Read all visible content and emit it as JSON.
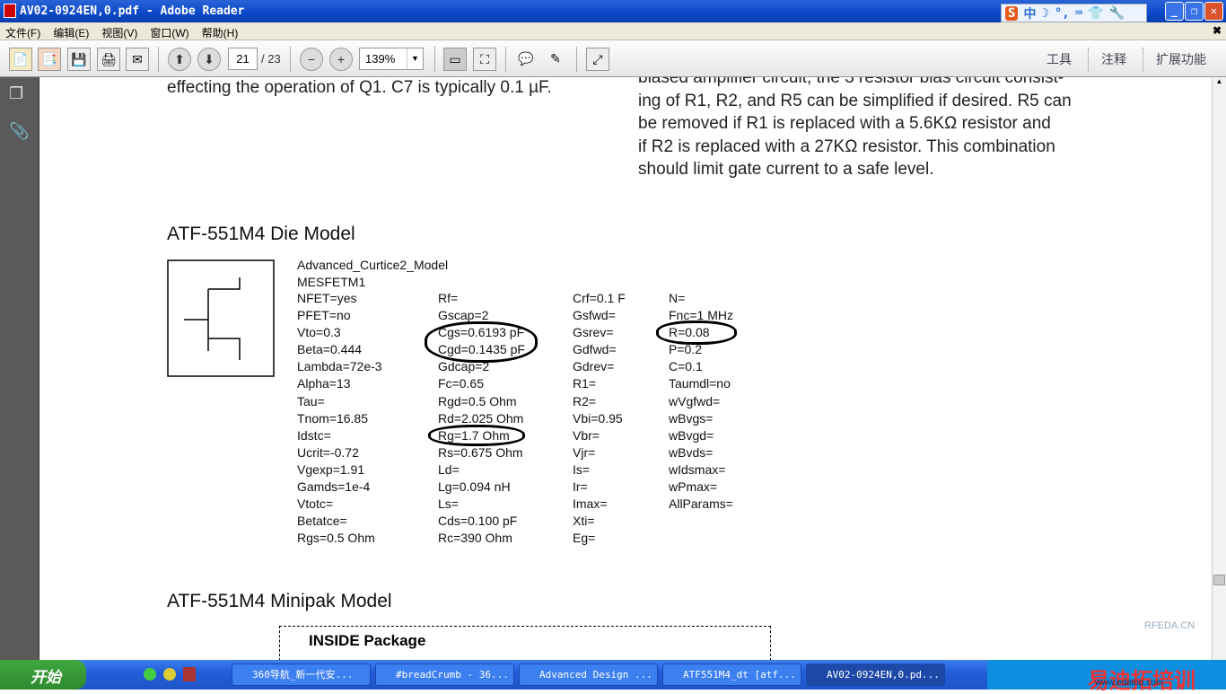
{
  "window": {
    "title": "AV02-0924EN,0.pdf - Adobe Reader",
    "ime": [
      "中",
      "☽",
      "°,",
      "⌨",
      "👕",
      "🔧"
    ]
  },
  "menu": [
    "文件(F)",
    "编辑(E)",
    "视图(V)",
    "窗口(W)",
    "帮助(H)"
  ],
  "toolbar": {
    "page_current": "21",
    "page_total": "/ 23",
    "zoom": "139%",
    "tools": "工具",
    "comment": "注释",
    "extended": "扩展功能"
  },
  "document": {
    "left_text": "effecting the operation of Q1. C7 is typically 0.1 µF.",
    "right_text": [
      "biased amplifier circuit, the 3 resistor bias circuit consist-",
      "ing of  R1, R2, and R5 can be simplified if desired. R5 can",
      "be removed if R1 is replaced with a 5.6KΩ resistor and",
      "if R2 is replaced with a 27KΩ resistor. This combination",
      "should limit gate current to a safe level."
    ],
    "die_heading": "ATF-551M4 Die Model",
    "model_name": "Advanced_Curtice2_Model",
    "model_id": "MESFETM1",
    "params": [
      [
        "NFET=yes",
        "PFET=no",
        "Vto=0.3",
        "Beta=0.444",
        "Lambda=72e-3",
        "Alpha=13",
        "Tau=",
        "Tnom=16.85",
        "Idstc=",
        "Ucrit=-0.72",
        "Vgexp=1.91",
        "Gamds=1e-4",
        "Vtotc=",
        "Betatce=",
        "Rgs=0.5 Ohm"
      ],
      [
        "Rf=",
        "Gscap=2",
        "Cgs=0.6193 pF",
        "Cgd=0.1435 pF",
        "Gdcap=2",
        "Fc=0.65",
        "Rgd=0.5 Ohm",
        "Rd=2.025 Ohm",
        "Rg=1.7 Ohm",
        "Rs=0.675 Ohm",
        "Ld=",
        "Lg=0.094 nH",
        "Ls=",
        "Cds=0.100 pF",
        "Rc=390 Ohm"
      ],
      [
        "Crf=0.1 F",
        "Gsfwd=",
        "Gsrev=",
        "Gdfwd=",
        "Gdrev=",
        "R1=",
        "R2=",
        "Vbi=0.95",
        "Vbr=",
        "Vjr=",
        "Is=",
        "Ir=",
        "Imax=",
        "Xti=",
        "Eg="
      ],
      [
        "N=",
        "Fnc=1 MHz",
        "R=0.08",
        "P=0.2",
        "C=0.1",
        "Taumdl=no",
        "wVgfwd=",
        "wBvgs=",
        "wBvgd=",
        "wBvds=",
        "wIdsmax=",
        "wPmax=",
        "AllParams="
      ]
    ],
    "minipak_heading": "ATF-551M4 Minipak Model",
    "inside_package": "INSIDE Package"
  },
  "taskbar": {
    "start": "开始",
    "tasks": [
      "360导航_新一代安...",
      "#breadCrumb - 36...",
      "Advanced Design ...",
      "ATF551M4_dt [atf...",
      "AV02-0924EN,0.pd..."
    ],
    "watermark": "易迪拓培训",
    "watermark_url": "www.edatop.com",
    "rfeda": "RFEDA.CN"
  }
}
